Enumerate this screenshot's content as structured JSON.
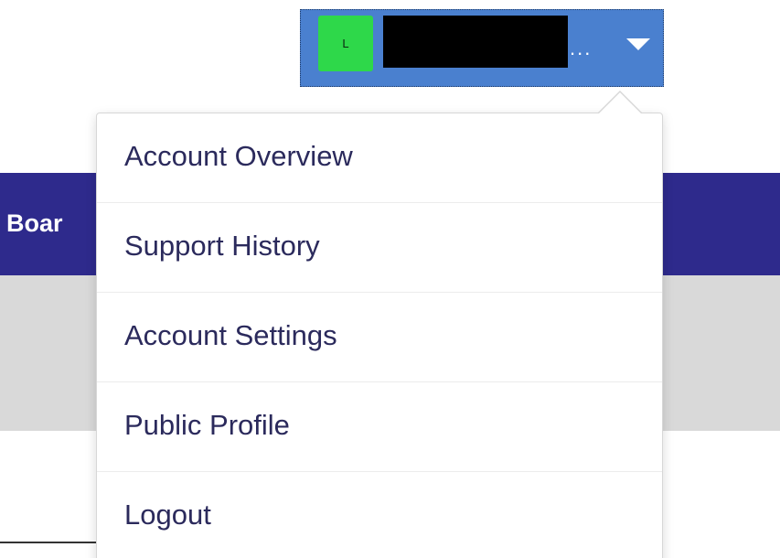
{
  "header": {
    "user": {
      "avatar_initial": "L",
      "name_truncation": "..."
    }
  },
  "nav": {
    "visible_item_label": "Boar"
  },
  "dropdown": {
    "items": [
      {
        "label": "Account Overview"
      },
      {
        "label": "Support History"
      },
      {
        "label": "Account Settings"
      },
      {
        "label": "Public Profile"
      },
      {
        "label": "Logout"
      }
    ]
  },
  "colors": {
    "nav_band": "#2e2a8c",
    "user_toggle": "#4a80cf",
    "avatar": "#2ed84a",
    "menu_text": "#2b2a5c",
    "gray_band": "#d9d9d9"
  }
}
